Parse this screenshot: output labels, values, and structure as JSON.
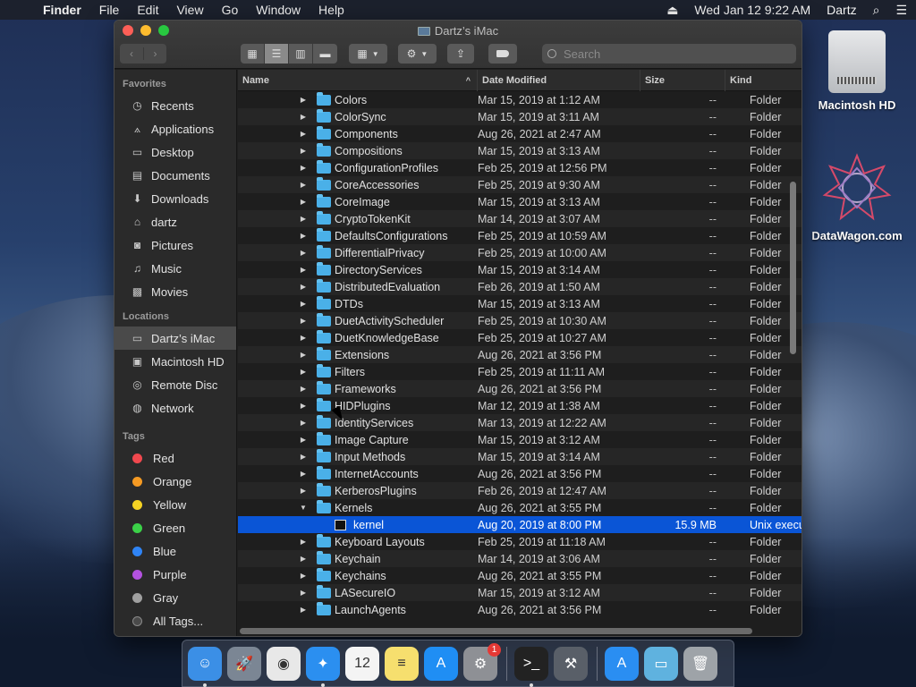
{
  "menubar": {
    "app": "Finder",
    "menus": [
      "File",
      "Edit",
      "View",
      "Go",
      "Window",
      "Help"
    ],
    "datetime": "Wed Jan 12  9:22 AM",
    "user": "Dartz"
  },
  "desktop": {
    "icons": [
      {
        "label": "Macintosh HD"
      },
      {
        "label": "DataWagon.com"
      }
    ]
  },
  "window": {
    "title": "Dartz’s iMac",
    "search_placeholder": "Search"
  },
  "sidebar": {
    "favorites_title": "Favorites",
    "favorites": [
      {
        "label": "Recents",
        "icon": "clock-icon"
      },
      {
        "label": "Applications",
        "icon": "applications-icon"
      },
      {
        "label": "Desktop",
        "icon": "desktop-icon"
      },
      {
        "label": "Documents",
        "icon": "document-icon"
      },
      {
        "label": "Downloads",
        "icon": "download-icon"
      },
      {
        "label": "dartz",
        "icon": "home-icon"
      },
      {
        "label": "Pictures",
        "icon": "camera-icon"
      },
      {
        "label": "Music",
        "icon": "music-icon"
      },
      {
        "label": "Movies",
        "icon": "film-icon"
      }
    ],
    "locations_title": "Locations",
    "locations": [
      {
        "label": "Dartz’s iMac",
        "icon": "imac-icon",
        "selected": true
      },
      {
        "label": "Macintosh HD",
        "icon": "disk-icon"
      },
      {
        "label": "Remote Disc",
        "icon": "disc-icon"
      },
      {
        "label": "Network",
        "icon": "globe-icon"
      }
    ],
    "tags_title": "Tags",
    "tags": [
      {
        "label": "Red",
        "color": "#f0484e"
      },
      {
        "label": "Orange",
        "color": "#f59a23"
      },
      {
        "label": "Yellow",
        "color": "#f5d323"
      },
      {
        "label": "Green",
        "color": "#3bd148"
      },
      {
        "label": "Blue",
        "color": "#2f84f5"
      },
      {
        "label": "Purple",
        "color": "#b452e0"
      },
      {
        "label": "Gray",
        "color": "#a0a0a0"
      },
      {
        "label": "All Tags...",
        "color": "#4a4a4a"
      }
    ]
  },
  "list": {
    "columns": {
      "name": "Name",
      "date": "Date Modified",
      "size": "Size",
      "kind": "Kind"
    },
    "rows": [
      {
        "name": "Colors",
        "date": "Mar 15, 2019 at 1:12 AM",
        "size": "--",
        "kind": "Folder"
      },
      {
        "name": "ColorSync",
        "date": "Mar 15, 2019 at 3:11 AM",
        "size": "--",
        "kind": "Folder"
      },
      {
        "name": "Components",
        "date": "Aug 26, 2021 at 2:47 AM",
        "size": "--",
        "kind": "Folder"
      },
      {
        "name": "Compositions",
        "date": "Mar 15, 2019 at 3:13 AM",
        "size": "--",
        "kind": "Folder"
      },
      {
        "name": "ConfigurationProfiles",
        "date": "Feb 25, 2019 at 12:56 PM",
        "size": "--",
        "kind": "Folder"
      },
      {
        "name": "CoreAccessories",
        "date": "Feb 25, 2019 at 9:30 AM",
        "size": "--",
        "kind": "Folder"
      },
      {
        "name": "CoreImage",
        "date": "Mar 15, 2019 at 3:13 AM",
        "size": "--",
        "kind": "Folder"
      },
      {
        "name": "CryptoTokenKit",
        "date": "Mar 14, 2019 at 3:07 AM",
        "size": "--",
        "kind": "Folder"
      },
      {
        "name": "DefaultsConfigurations",
        "date": "Feb 25, 2019 at 10:59 AM",
        "size": "--",
        "kind": "Folder"
      },
      {
        "name": "DifferentialPrivacy",
        "date": "Feb 25, 2019 at 10:00 AM",
        "size": "--",
        "kind": "Folder"
      },
      {
        "name": "DirectoryServices",
        "date": "Mar 15, 2019 at 3:14 AM",
        "size": "--",
        "kind": "Folder"
      },
      {
        "name": "DistributedEvaluation",
        "date": "Feb 26, 2019 at 1:50 AM",
        "size": "--",
        "kind": "Folder"
      },
      {
        "name": "DTDs",
        "date": "Mar 15, 2019 at 3:13 AM",
        "size": "--",
        "kind": "Folder"
      },
      {
        "name": "DuetActivityScheduler",
        "date": "Feb 25, 2019 at 10:30 AM",
        "size": "--",
        "kind": "Folder"
      },
      {
        "name": "DuetKnowledgeBase",
        "date": "Feb 25, 2019 at 10:27 AM",
        "size": "--",
        "kind": "Folder"
      },
      {
        "name": "Extensions",
        "date": "Aug 26, 2021 at 3:56 PM",
        "size": "--",
        "kind": "Folder"
      },
      {
        "name": "Filters",
        "date": "Feb 25, 2019 at 11:11 AM",
        "size": "--",
        "kind": "Folder"
      },
      {
        "name": "Frameworks",
        "date": "Aug 26, 2021 at 3:56 PM",
        "size": "--",
        "kind": "Folder"
      },
      {
        "name": "HIDPlugins",
        "date": "Mar 12, 2019 at 1:38 AM",
        "size": "--",
        "kind": "Folder"
      },
      {
        "name": "IdentityServices",
        "date": "Mar 13, 2019 at 12:22 AM",
        "size": "--",
        "kind": "Folder"
      },
      {
        "name": "Image Capture",
        "date": "Mar 15, 2019 at 3:12 AM",
        "size": "--",
        "kind": "Folder"
      },
      {
        "name": "Input Methods",
        "date": "Mar 15, 2019 at 3:14 AM",
        "size": "--",
        "kind": "Folder"
      },
      {
        "name": "InternetAccounts",
        "date": "Aug 26, 2021 at 3:56 PM",
        "size": "--",
        "kind": "Folder"
      },
      {
        "name": "KerberosPlugins",
        "date": "Feb 26, 2019 at 12:47 AM",
        "size": "--",
        "kind": "Folder"
      },
      {
        "name": "Kernels",
        "date": "Aug 26, 2021 at 3:55 PM",
        "size": "--",
        "kind": "Folder",
        "expanded": true
      },
      {
        "name": "kernel",
        "date": "Aug 20, 2019 at 8:00 PM",
        "size": "15.9 MB",
        "kind": "Unix executable",
        "child": true,
        "selected": true
      },
      {
        "name": "Keyboard Layouts",
        "date": "Feb 25, 2019 at 11:18 AM",
        "size": "--",
        "kind": "Folder"
      },
      {
        "name": "Keychain",
        "date": "Mar 14, 2019 at 3:06 AM",
        "size": "--",
        "kind": "Folder"
      },
      {
        "name": "Keychains",
        "date": "Aug 26, 2021 at 3:55 PM",
        "size": "--",
        "kind": "Folder"
      },
      {
        "name": "LASecureIO",
        "date": "Mar 15, 2019 at 3:12 AM",
        "size": "--",
        "kind": "Folder"
      },
      {
        "name": "LaunchAgents",
        "date": "Aug 26, 2021 at 3:56 PM",
        "size": "--",
        "kind": "Folder"
      }
    ]
  },
  "dock": {
    "apps": [
      {
        "name": "Finder",
        "color": "#3b8fe6",
        "glyph": "☺",
        "running": true
      },
      {
        "name": "Launchpad",
        "color": "#7b8694",
        "glyph": "🚀"
      },
      {
        "name": "Chrome",
        "color": "#e8e8e8",
        "glyph": "◉"
      },
      {
        "name": "Safari",
        "color": "#2b8ff0",
        "glyph": "✦",
        "running": true
      },
      {
        "name": "Calendar",
        "color": "#f4f4f4",
        "glyph": "12"
      },
      {
        "name": "Notes",
        "color": "#f6df6e",
        "glyph": "≡"
      },
      {
        "name": "App Store",
        "color": "#1f8ef4",
        "glyph": "A"
      },
      {
        "name": "System Preferences",
        "color": "#8e9095",
        "glyph": "⚙",
        "badge": "1"
      },
      {
        "name": "Terminal",
        "color": "#222222",
        "glyph": ">_",
        "running": true
      },
      {
        "name": "Instruments",
        "color": "#595f68",
        "glyph": "⚒"
      },
      {
        "name": "App Store Downloads",
        "color": "#2a8ef2",
        "glyph": "A"
      },
      {
        "name": "Applications Folder",
        "color": "#5fb2df",
        "glyph": "▭"
      },
      {
        "name": "Trash",
        "color": "#9ea3a8",
        "glyph": "🗑"
      }
    ]
  }
}
